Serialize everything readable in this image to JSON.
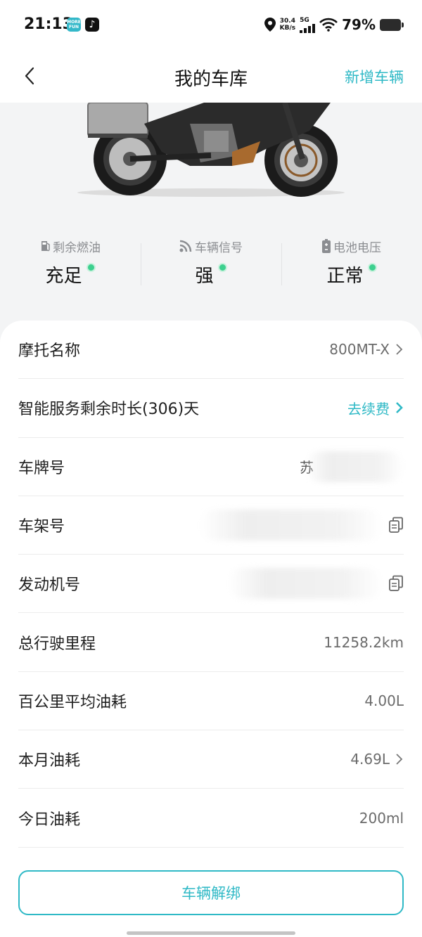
{
  "status_bar": {
    "time": "21:13",
    "app_badge_1": "MORE FUN",
    "app_badge_2_icon": "tiktok-icon",
    "net_speed_value": "30.4",
    "net_speed_unit": "KB/s",
    "network": "5G",
    "battery": "79%"
  },
  "header": {
    "title": "我的车库",
    "add_vehicle": "新增车辆"
  },
  "stats": [
    {
      "label": "剩余燃油",
      "value": "充足",
      "icon": "fuel-icon"
    },
    {
      "label": "车辆信号",
      "value": "强",
      "icon": "signal-icon"
    },
    {
      "label": "电池电压",
      "value": "正常",
      "icon": "battery-icon"
    }
  ],
  "details": {
    "moto_name": {
      "label": "摩托名称",
      "value": "800MT-X"
    },
    "service": {
      "label": "智能服务剩余时长(306)天",
      "action": "去续费"
    },
    "plate": {
      "label": "车牌号",
      "value": "苏"
    },
    "frame": {
      "label": "车架号"
    },
    "engine": {
      "label": "发动机号"
    },
    "mileage": {
      "label": "总行驶里程",
      "value": "11258.2km"
    },
    "avg_consumption": {
      "label": "百公里平均油耗",
      "value": "4.00L"
    },
    "month_consumption": {
      "label": "本月油耗",
      "value": "4.69L"
    },
    "today_consumption": {
      "label": "今日油耗",
      "value": "200ml"
    }
  },
  "unbind_button": "车辆解绑",
  "colors": {
    "accent": "#2fb9c6",
    "status_ok": "#3dd08f",
    "background": "#f3f4f5"
  }
}
